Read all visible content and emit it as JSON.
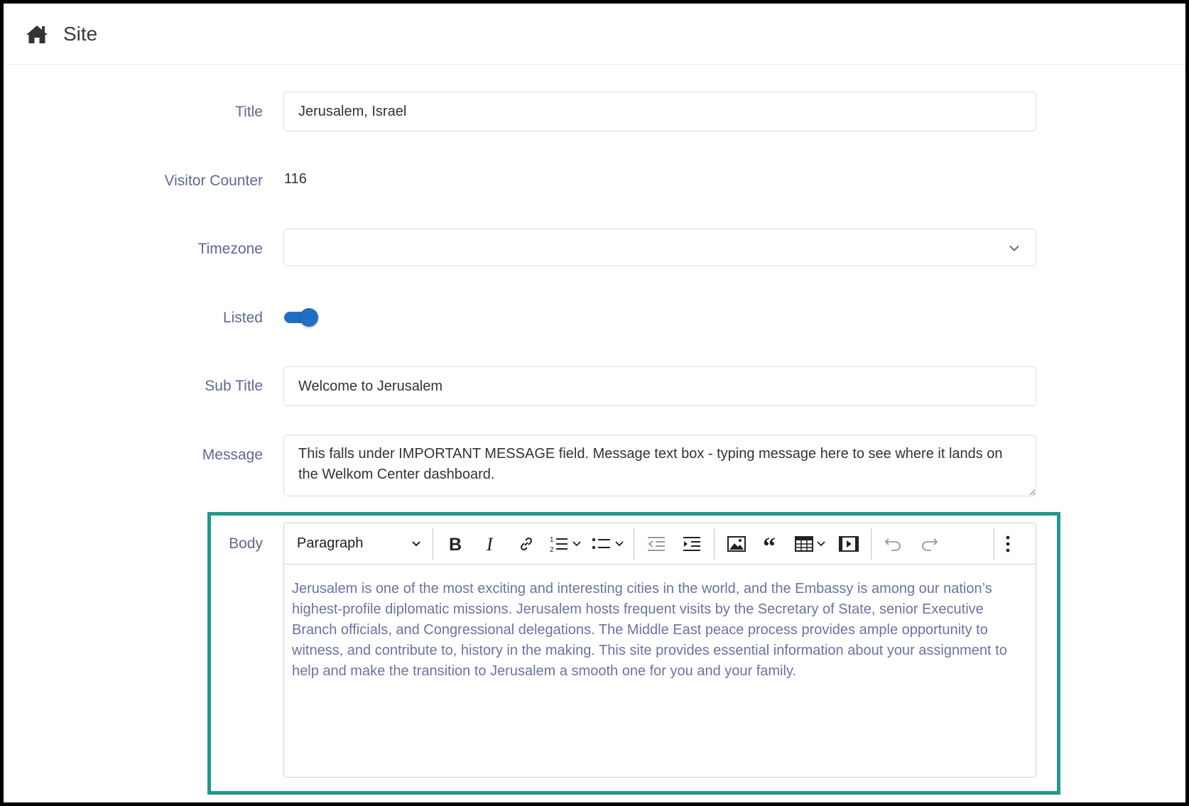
{
  "header": {
    "title": "Site",
    "icon": "home-icon"
  },
  "form": {
    "title": {
      "label": "Title",
      "value": "Jerusalem, Israel"
    },
    "visitor_counter": {
      "label": "Visitor Counter",
      "value": "116"
    },
    "timezone": {
      "label": "Timezone",
      "value": ""
    },
    "listed": {
      "label": "Listed",
      "checked": true
    },
    "sub_title": {
      "label": "Sub Title",
      "value": "Welcome to Jerusalem"
    },
    "message": {
      "label": "Message",
      "value": "This falls under IMPORTANT MESSAGE field. Message text box - typing message here to see where it lands on the Welkom Center dashboard."
    },
    "body": {
      "label": "Body",
      "toolbar": {
        "heading_select": "Paragraph",
        "buttons": [
          "bold-icon",
          "italic-icon",
          "link-icon",
          "numbered-list-icon",
          "bulleted-list-icon",
          "outdent-icon",
          "indent-icon",
          "image-icon",
          "blockquote-icon",
          "table-icon",
          "media-embed-icon",
          "undo-icon",
          "redo-icon",
          "more-options-icon"
        ]
      },
      "content": "Jerusalem is one of the most exciting and interesting cities in the world, and the Embassy is among our nation’s highest-profile diplomatic missions. Jerusalem hosts frequent visits by the Secretary of State, senior Executive Branch officials, and Congressional delegations. The Middle East peace process provides ample opportunity to witness, and contribute to, history in the making. This site provides essential information about your assignment to help and make the transition to Jerusalem a smooth one for you and your family."
    }
  },
  "colors": {
    "label": "#5f6893",
    "accent": "#1f6fc4",
    "highlight_border": "#1e9a8a",
    "body_text": "#6b73a0"
  }
}
